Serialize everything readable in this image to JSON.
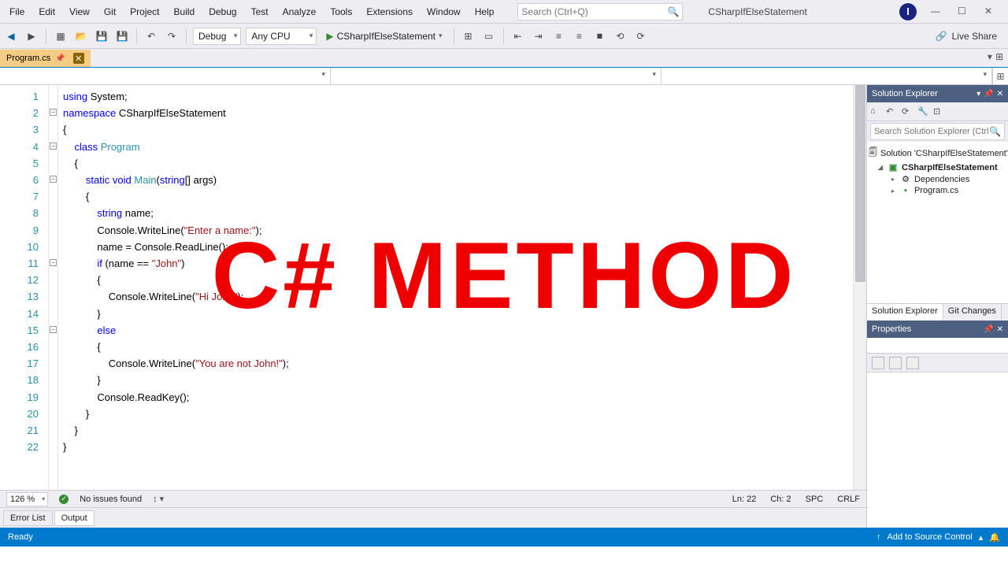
{
  "menu": [
    "File",
    "Edit",
    "View",
    "Git",
    "Project",
    "Build",
    "Debug",
    "Test",
    "Analyze",
    "Tools",
    "Extensions",
    "Window",
    "Help"
  ],
  "search_placeholder": "Search (Ctrl+Q)",
  "solution_name": "CSharpIfElseStatement",
  "avatar_letter": "I",
  "toolbar": {
    "config": "Debug",
    "platform": "Any CPU",
    "start_target": "CSharpIfElseStatement",
    "liveshare": "Live Share"
  },
  "tab": {
    "name": "Program.cs"
  },
  "code_lines": [
    {
      "n": 1,
      "segs": [
        [
          "kw",
          "using"
        ],
        [
          "pln",
          " System;"
        ]
      ]
    },
    {
      "n": 2,
      "segs": [
        [
          "kw",
          "namespace"
        ],
        [
          "pln",
          " CSharpIfElseStatement"
        ]
      ]
    },
    {
      "n": 3,
      "segs": [
        [
          "pln",
          "{"
        ]
      ]
    },
    {
      "n": 4,
      "segs": [
        [
          "pln",
          "    "
        ],
        [
          "kw",
          "class"
        ],
        [
          "pln",
          " "
        ],
        [
          "cls",
          "Program"
        ]
      ]
    },
    {
      "n": 5,
      "segs": [
        [
          "pln",
          "    {"
        ]
      ]
    },
    {
      "n": 6,
      "segs": [
        [
          "pln",
          "        "
        ],
        [
          "kw",
          "static"
        ],
        [
          "pln",
          " "
        ],
        [
          "kw",
          "void"
        ],
        [
          "pln",
          " "
        ],
        [
          "cls",
          "Main"
        ],
        [
          "pln",
          "("
        ],
        [
          "kw",
          "string"
        ],
        [
          "pln",
          "[] args)"
        ]
      ]
    },
    {
      "n": 7,
      "segs": [
        [
          "pln",
          "        {"
        ]
      ]
    },
    {
      "n": 8,
      "segs": [
        [
          "pln",
          "            "
        ],
        [
          "kw",
          "string"
        ],
        [
          "pln",
          " name;"
        ]
      ]
    },
    {
      "n": 9,
      "segs": [
        [
          "pln",
          "            Console.WriteLine("
        ],
        [
          "str",
          "\"Enter a name:\""
        ],
        [
          "pln",
          ");"
        ]
      ]
    },
    {
      "n": 10,
      "segs": [
        [
          "pln",
          "            name = Console.ReadLine();"
        ]
      ]
    },
    {
      "n": 11,
      "segs": [
        [
          "pln",
          "            "
        ],
        [
          "kw",
          "if"
        ],
        [
          "pln",
          " (name == "
        ],
        [
          "str",
          "\"John\""
        ],
        [
          "pln",
          ")"
        ]
      ]
    },
    {
      "n": 12,
      "segs": [
        [
          "pln",
          "            {"
        ]
      ]
    },
    {
      "n": 13,
      "segs": [
        [
          "pln",
          "                Console.WriteLine("
        ],
        [
          "str",
          "\"Hi John\""
        ],
        [
          "pln",
          ");"
        ]
      ]
    },
    {
      "n": 14,
      "segs": [
        [
          "pln",
          "            }"
        ]
      ]
    },
    {
      "n": 15,
      "segs": [
        [
          "pln",
          "            "
        ],
        [
          "kw",
          "else"
        ]
      ]
    },
    {
      "n": 16,
      "segs": [
        [
          "pln",
          "            {"
        ]
      ]
    },
    {
      "n": 17,
      "segs": [
        [
          "pln",
          "                Console.WriteLine("
        ],
        [
          "str",
          "\"You are not John!\""
        ],
        [
          "pln",
          ");"
        ]
      ]
    },
    {
      "n": 18,
      "segs": [
        [
          "pln",
          "            }"
        ]
      ]
    },
    {
      "n": 19,
      "segs": [
        [
          "pln",
          "            Console.ReadKey();"
        ]
      ]
    },
    {
      "n": 20,
      "segs": [
        [
          "pln",
          "        }"
        ]
      ]
    },
    {
      "n": 21,
      "segs": [
        [
          "pln",
          "    }"
        ]
      ]
    },
    {
      "n": 22,
      "segs": [
        [
          "pln",
          "}"
        ]
      ]
    }
  ],
  "folds": [
    2,
    4,
    6,
    11,
    15
  ],
  "ed_status": {
    "zoom": "126 %",
    "issues": "No issues found",
    "ln": "Ln: 22",
    "ch": "Ch: 2",
    "spc": "SPC",
    "crlf": "CRLF"
  },
  "out_tabs": [
    "Error List",
    "Output"
  ],
  "statusbar": {
    "ready": "Ready",
    "source_control": "Add to Source Control"
  },
  "se": {
    "title": "Solution Explorer",
    "search_placeholder": "Search Solution Explorer (Ctrl+;)",
    "nodes": {
      "solution": "Solution 'CSharpIfElseStatement'",
      "project": "CSharpIfElseStatement",
      "deps": "Dependencies",
      "file": "Program.cs"
    },
    "tabs": [
      "Solution Explorer",
      "Git Changes"
    ]
  },
  "props": {
    "title": "Properties"
  },
  "overlay": "C# METHOD"
}
